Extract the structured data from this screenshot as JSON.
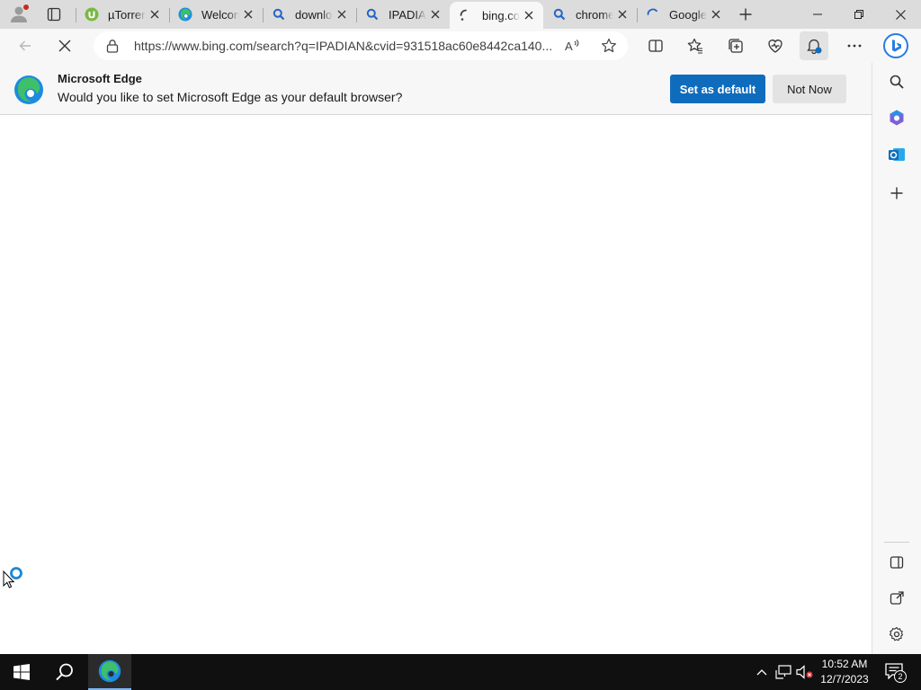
{
  "browser": {
    "tabs": [
      {
        "title": "µTorrent",
        "favicon": "utorrent-icon",
        "active": false
      },
      {
        "title": "Welcome",
        "favicon": "edge-icon",
        "active": false
      },
      {
        "title": "download",
        "favicon": "search-icon",
        "active": false
      },
      {
        "title": "IPADIAN",
        "favicon": "search-icon",
        "active": false
      },
      {
        "title": "bing.com",
        "favicon": "loading-icon",
        "active": true
      },
      {
        "title": "chrome",
        "favicon": "search-icon",
        "active": false
      },
      {
        "title": "Google",
        "favicon": "loading-icon",
        "active": false
      }
    ],
    "address": {
      "url": "https://www.bing.com/search?q=IPADIAN&cvid=931518ac60e8442ca140..."
    },
    "toolbar_icons": [
      "back-icon",
      "stop-icon",
      "lock-icon",
      "read-aloud-icon",
      "favorite-star-icon",
      "split-screen-icon",
      "favorites-icon",
      "collections-icon",
      "browser-essentials-icon",
      "notifications-icon",
      "more-icon",
      "copilot-icon"
    ]
  },
  "infobar": {
    "title": "Microsoft Edge",
    "message": "Would you like to set Microsoft Edge as your default browser?",
    "primary_button": "Set as default",
    "secondary_button": "Not Now"
  },
  "sidebar": {
    "items": [
      "search-icon",
      "office-icon",
      "outlook-icon",
      "add-icon"
    ],
    "bottom_items": [
      "hide-sidebar-icon",
      "open-external-icon",
      "settings-icon"
    ]
  },
  "taskbar": {
    "time": "10:52 AM",
    "date": "12/7/2023",
    "notification_count": "2"
  },
  "colors": {
    "accent": "#0f6cbd",
    "edge_blue": "#1c8be0",
    "edge_green": "#3fbf6a",
    "taskbar": "#101010"
  }
}
